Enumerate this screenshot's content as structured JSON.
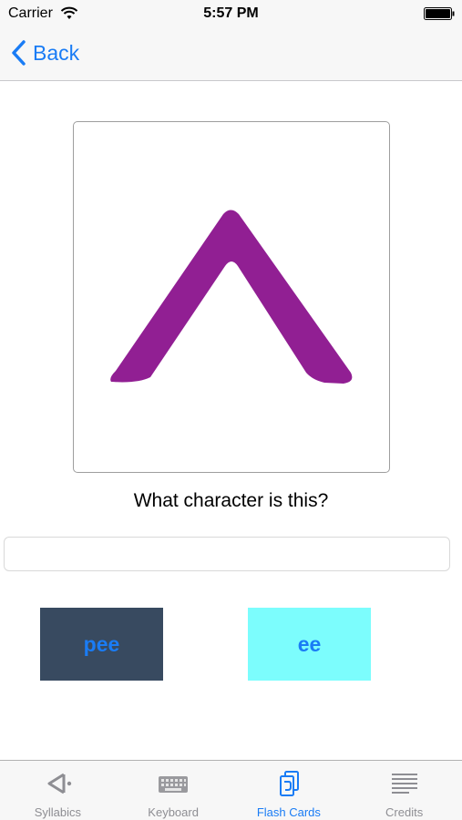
{
  "status_bar": {
    "carrier": "Carrier",
    "time": "5:57 PM"
  },
  "nav": {
    "back_label": "Back"
  },
  "card": {
    "symbol_icon": "syllabic-caret-icon",
    "symbol_color": "#911f93"
  },
  "question": "What character is this?",
  "answer_input": {
    "value": "",
    "placeholder": ""
  },
  "choices": [
    {
      "label": "pee",
      "background": "#384a60"
    },
    {
      "label": "ee",
      "background": "#7cfdfd"
    }
  ],
  "tabs": [
    {
      "label": "Syllabics",
      "icon": "syllabics-icon",
      "active": false
    },
    {
      "label": "Keyboard",
      "icon": "keyboard-icon",
      "active": false
    },
    {
      "label": "Flash Cards",
      "icon": "flash-cards-icon",
      "active": true
    },
    {
      "label": "Credits",
      "icon": "credits-icon",
      "active": false
    }
  ],
  "colors": {
    "accent": "#1a7cf5",
    "inactive_tab": "#8e8e93"
  }
}
